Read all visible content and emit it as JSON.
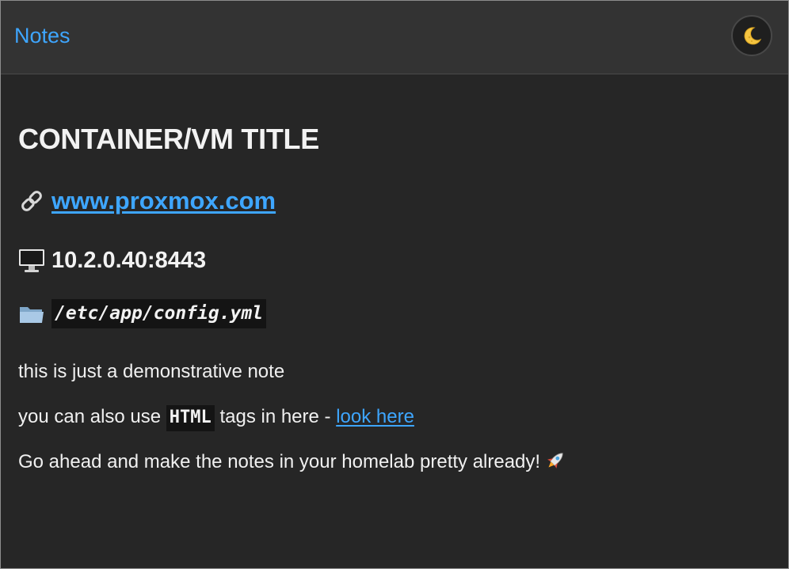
{
  "header": {
    "title": "Notes",
    "theme_toggle_icon": "moon-icon"
  },
  "note": {
    "title": "CONTAINER/VM TITLE",
    "website": {
      "icon": "link-icon",
      "text": "www.proxmox.com"
    },
    "address": {
      "icon": "desktop-computer-icon",
      "text": "10.2.0.40:8443"
    },
    "path": {
      "icon": "folder-icon",
      "text": "/etc/app/config.yml"
    },
    "paragraph1": "this is just a demonstrative note",
    "paragraph2": {
      "before": "you can also use ",
      "code": "HTML",
      "middle": " tags in here - ",
      "link": "look here"
    },
    "paragraph3": {
      "text": "Go ahead and make the notes in your homelab pretty already!",
      "icon": "rocket-icon"
    }
  },
  "colors": {
    "accent_link": "#3ea6ff",
    "background": "#262626",
    "header_background": "#333333",
    "text": "#f2f2f2",
    "code_background": "#141414"
  }
}
